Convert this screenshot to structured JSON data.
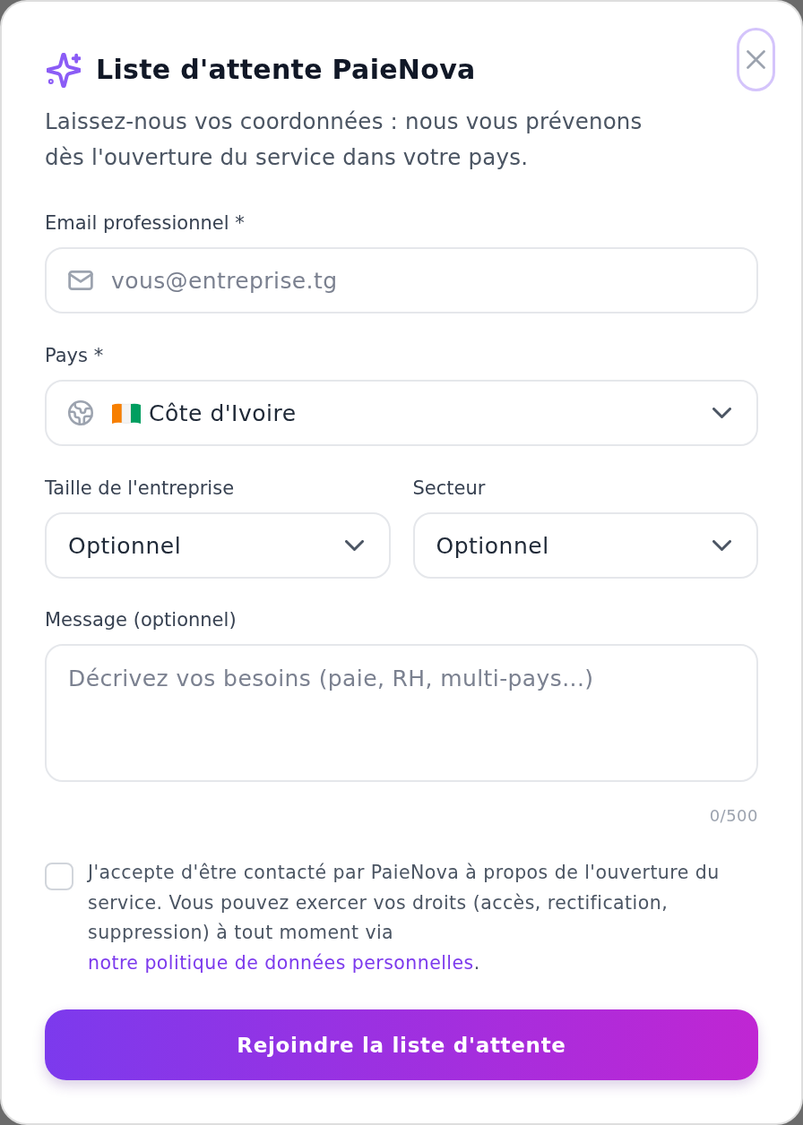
{
  "header": {
    "title": "Liste d'attente PaieNova",
    "subtitle": "Laissez-nous vos coordonnées : nous vous prévenons dès l'ouverture du service dans votre pays.",
    "close_button": {
      "focused": true
    }
  },
  "email_field": {
    "label": "Email professionnel *",
    "placeholder": "vous@entreprise.tg"
  },
  "country_field": {
    "label": "Pays *",
    "value": "Côte d'Ivoire"
  },
  "company_size_field": {
    "label": "Taille de l'entreprise",
    "value": "Optionnel"
  },
  "sector_field": {
    "label": "Secteur",
    "value": "Optionnel"
  },
  "message_field": {
    "label": "Message (optionnel)",
    "placeholder": "Décrivez vos besoins (paie, RH, multi-pays...)",
    "counter": "0/500"
  },
  "consent": {
    "checked": false,
    "text": "J'accepte d'être contacté par PaieNova à propos de l'ouverture du service. Vous pouvez exercer vos droits (accès, rectification, suppression) à tout moment via",
    "link": "notre politique de données personnelles",
    "text_end": "."
  },
  "submit_button": {
    "label": "Rejoindre la liste d'attente"
  }
}
